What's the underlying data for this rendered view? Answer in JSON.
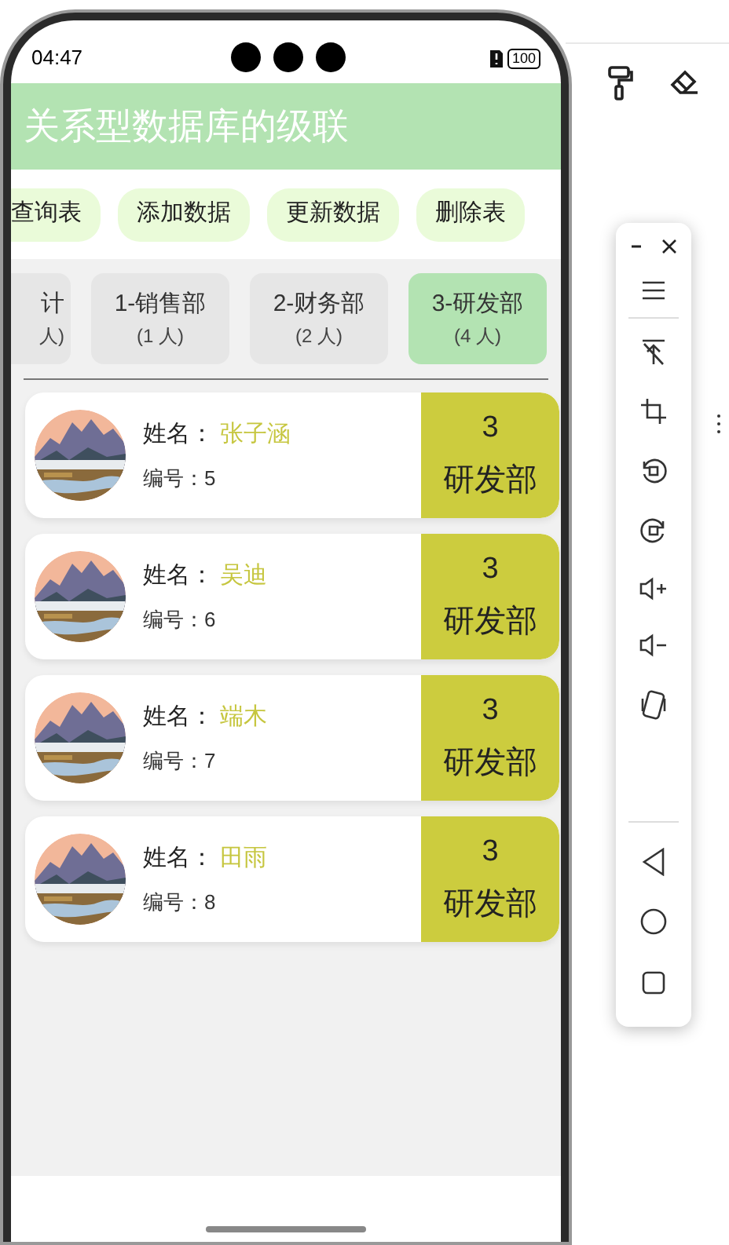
{
  "status_bar": {
    "time": "04:47",
    "battery": "100"
  },
  "title": "关系型数据库的级联",
  "actions": [
    "查询表",
    "添加数据",
    "更新数据",
    "删除表"
  ],
  "tabs": [
    {
      "label": "计",
      "count": "人)",
      "selected": false
    },
    {
      "label": "1-销售部",
      "count": "(1 人)",
      "selected": false
    },
    {
      "label": "2-财务部",
      "count": "(2 人)",
      "selected": false
    },
    {
      "label": "3-研发部",
      "count": "(4 人)",
      "selected": true
    }
  ],
  "employees": [
    {
      "name_label": "姓名：",
      "name": "张子涵",
      "id_label": "编号：",
      "id": "5",
      "dept_id": "3",
      "dept_name": "研发部"
    },
    {
      "name_label": "姓名：",
      "name": "吴迪",
      "id_label": "编号：",
      "id": "6",
      "dept_id": "3",
      "dept_name": "研发部"
    },
    {
      "name_label": "姓名：",
      "name": "端木",
      "id_label": "编号：",
      "id": "7",
      "dept_id": "3",
      "dept_name": "研发部"
    },
    {
      "name_label": "姓名：",
      "name": "田雨",
      "id_label": "编号：",
      "id": "8",
      "dept_id": "3",
      "dept_name": "研发部"
    }
  ]
}
